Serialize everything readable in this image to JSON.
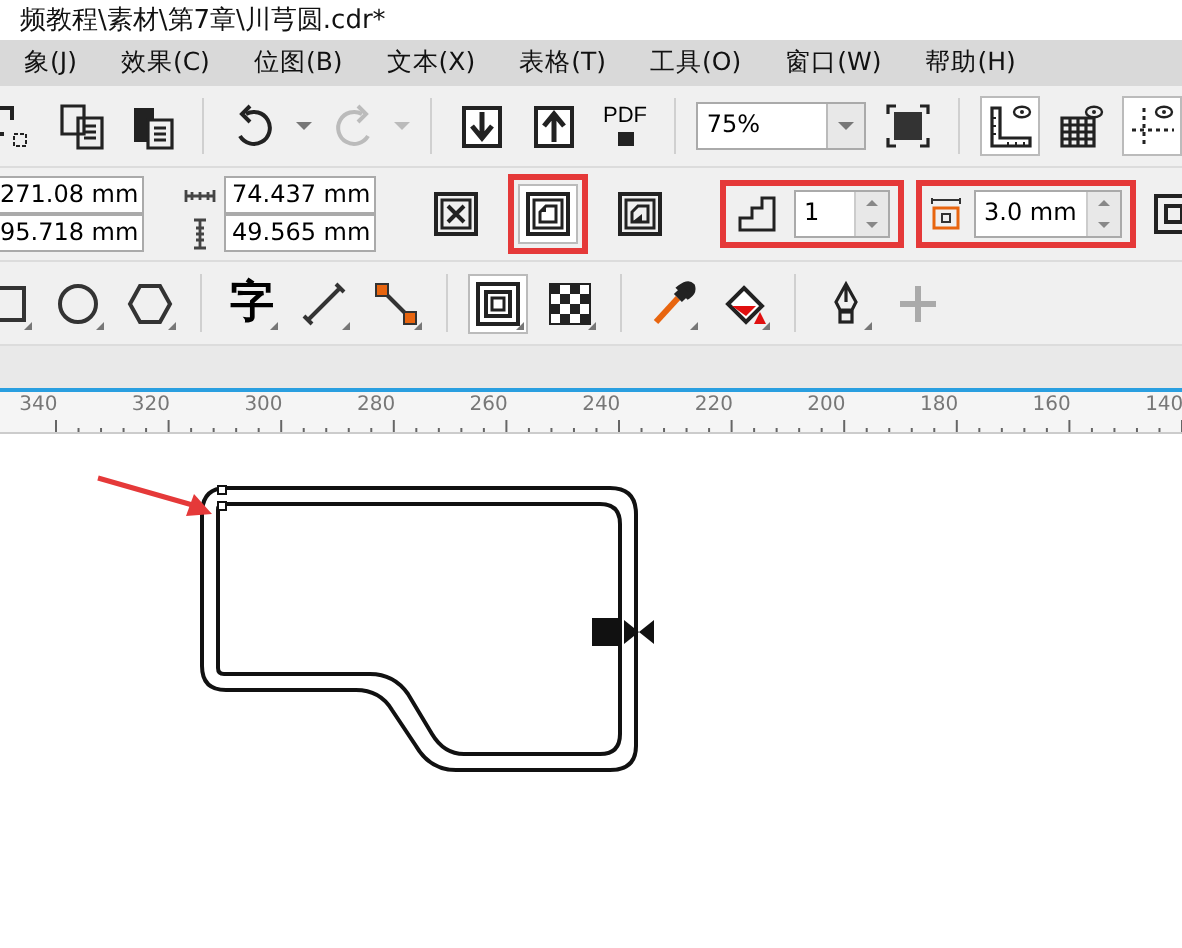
{
  "window": {
    "title": "频教程\\素材\\第7章\\川芎圆.cdr*"
  },
  "menu": [
    "象(J)",
    "效果(C)",
    "位图(B)",
    "文本(X)",
    "表格(T)",
    "工具(O)",
    "窗口(W)",
    "帮助(H)"
  ],
  "toolbar": {
    "zoom": "75%",
    "pdf_label": "PDF",
    "view_toggles": [
      {
        "kind": "rulers",
        "selected": true
      },
      {
        "kind": "grid",
        "selected": false
      },
      {
        "kind": "guidelines",
        "selected": true
      }
    ]
  },
  "property_bar": {
    "x": "271.08 mm",
    "y": "95.718 mm",
    "width": "74.437 mm",
    "height": "49.565 mm",
    "contour_directions": [
      {
        "kind": "center",
        "selected": false,
        "highlighted": false
      },
      {
        "kind": "inside",
        "selected": true,
        "highlighted": true
      },
      {
        "kind": "outside",
        "selected": false,
        "highlighted": false
      }
    ],
    "steps": {
      "value": "1",
      "highlighted": true
    },
    "offset": {
      "value": "3.0 mm",
      "highlighted": true
    }
  },
  "toolbox": [
    {
      "kind": "rectangle",
      "selected": false
    },
    {
      "kind": "ellipse",
      "selected": false
    },
    {
      "kind": "polygon",
      "selected": false
    },
    {
      "kind": "text",
      "label": "字",
      "selected": false
    },
    {
      "kind": "dimension",
      "selected": false
    },
    {
      "kind": "connector",
      "selected": false
    },
    {
      "kind": "contour",
      "selected": true
    },
    {
      "kind": "transparency",
      "selected": false
    },
    {
      "kind": "eyedropper",
      "selected": false
    },
    {
      "kind": "fill",
      "selected": false
    },
    {
      "kind": "pen",
      "selected": false
    },
    {
      "kind": "add",
      "selected": false
    }
  ],
  "ruler": {
    "labels": [
      "340",
      "320",
      "300",
      "280",
      "260",
      "240",
      "220",
      "200",
      "180",
      "160",
      "140"
    ]
  }
}
